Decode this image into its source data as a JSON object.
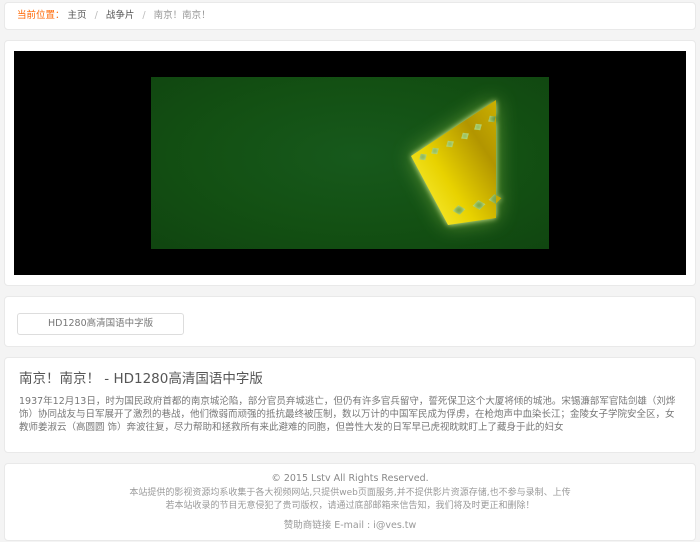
{
  "breadcrumb": {
    "prefix": "当前位置：",
    "separator": "/",
    "items": [
      {
        "label": "主页"
      },
      {
        "label": "战争片"
      },
      {
        "label": "南京！南京！"
      }
    ]
  },
  "player": {
    "placeholder_icon": "film-strip-icon",
    "colors": {
      "screen_bg": "#000000",
      "placeholder_green": "#135013",
      "film_yellow_bright": "#faf02a",
      "film_yellow_dark": "#a08600"
    }
  },
  "episodes": {
    "buttons": [
      {
        "label": "HD1280高清国语中字版"
      }
    ]
  },
  "detail": {
    "title": "南京！南京！ - HD1280高清国语中字版",
    "description": "1937年12月13日，时为国民政府首都的南京城沦陷，部分官员弃城逃亡，但仍有许多官兵留守，誓死保卫这个大厦将倾的城池。宋锡濂部军官陆剑雄（刘烨 饰）协同战友与日军展开了激烈的巷战，他们微弱而顽强的抵抗最终被压制，数以万计的中国军民成为俘虏，在枪炮声中血染长江；金陵女子学院安全区，女教师姜淑云（高圆圆 饰）奔波往复，尽力帮助和拯救所有来此避难的同胞，但兽性大发的日军早已虎视眈眈盯上了藏身于此的妇女"
  },
  "footer": {
    "copyright": "© 2015 Lstv All Rights Reserved.",
    "disclaimer1": "本站提供的影视资源均系收集于各大视频网站,只提供web页面服务,并不提供影片资源存储,也不参与录制、上传",
    "disclaimer2": "若本站收录的节目无意侵犯了贵司版权，请通过底部邮箱来信告知，我们将及时更正和删除！",
    "sponsor": "赞助商链接  E-mail : i@ves.tw"
  },
  "colors": {
    "page_bg": "#f4f4f4",
    "panel_border": "#e9e9e9",
    "breadcrumb_prefix": "#ff6600",
    "link_text": "#555555",
    "muted_text": "#999999"
  }
}
